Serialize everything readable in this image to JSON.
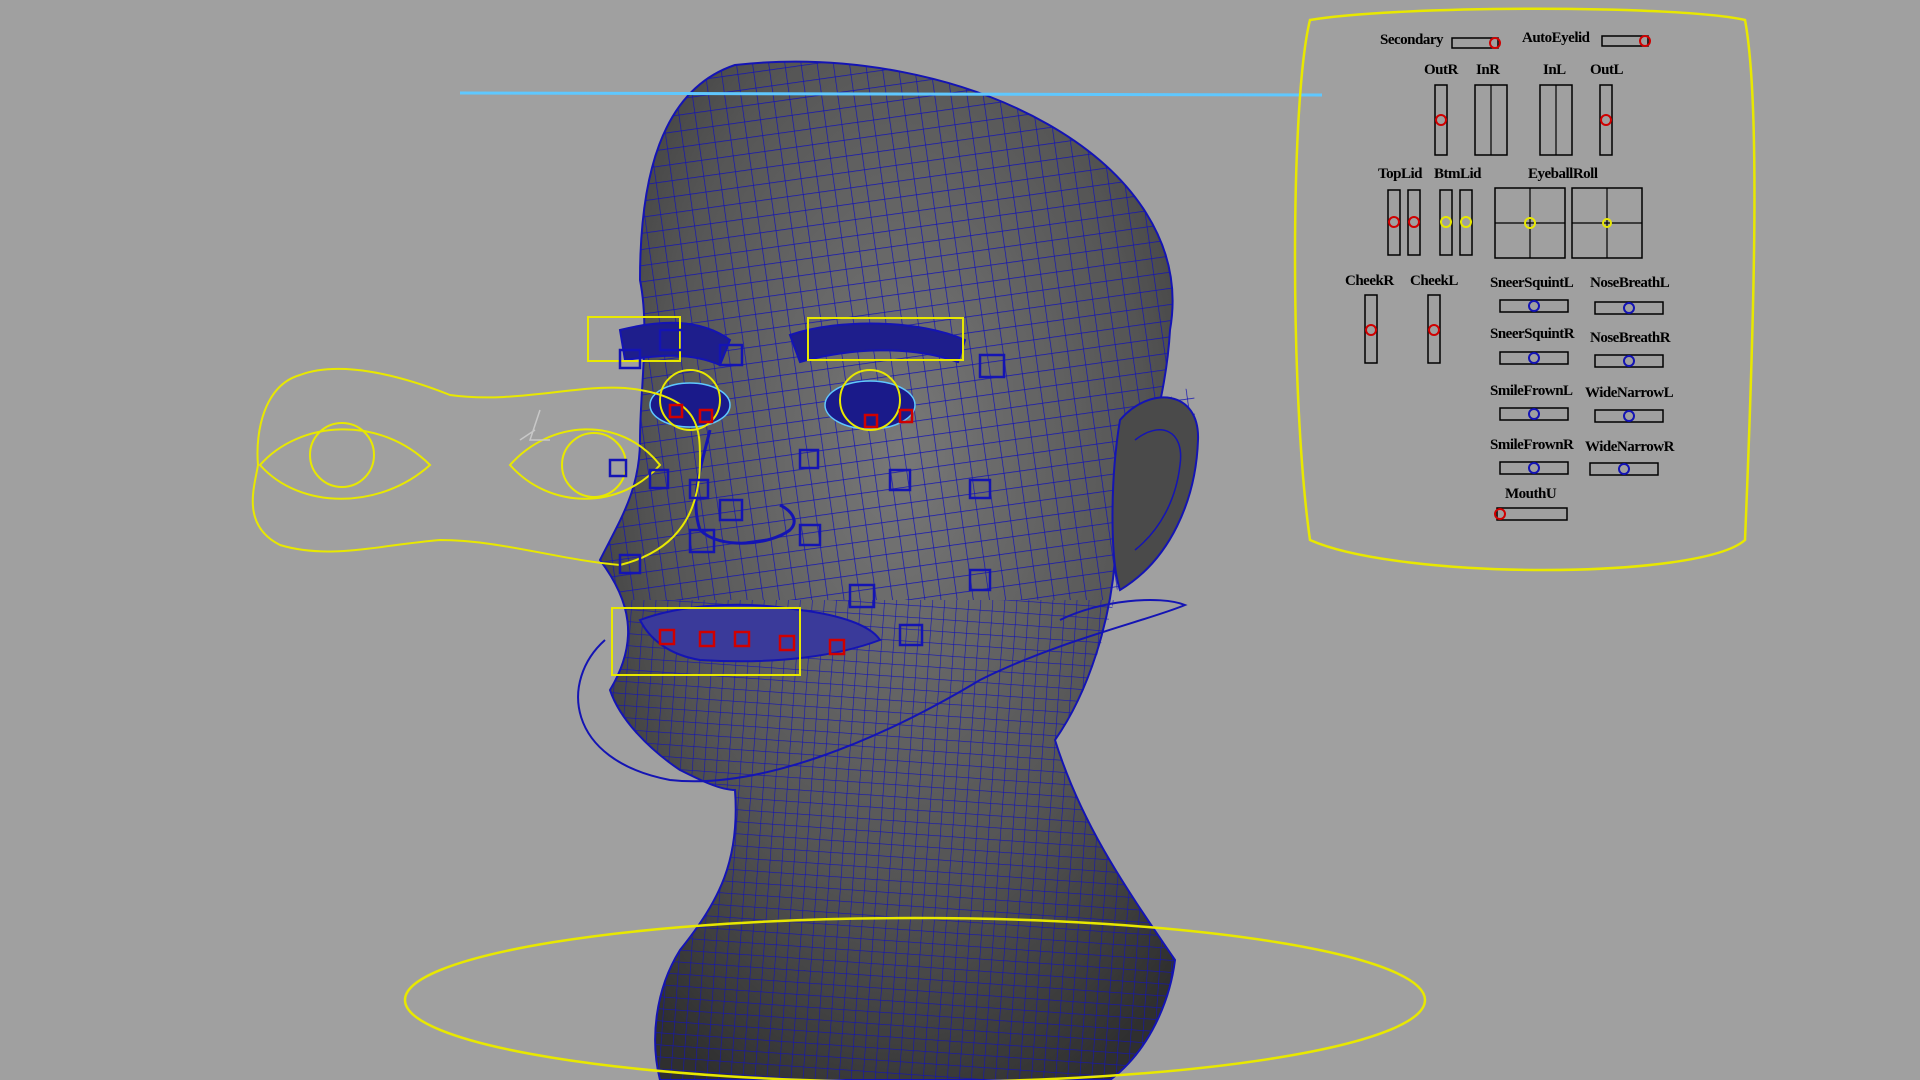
{
  "viewport": {
    "name": "perspective viewport",
    "background": "#a0a0a0",
    "mesh_color": "#1414b4",
    "curve_color": "#e8e800",
    "selected_color": "#5fc8ff",
    "locator_color": "#d00000"
  },
  "control_panel": {
    "secondary": "Secondary",
    "auto_eyelid": "AutoEyelid",
    "out_r": "OutR",
    "in_r": "InR",
    "in_l": "InL",
    "out_l": "OutL",
    "top_lid": "TopLid",
    "btm_lid": "BtmLid",
    "eyeball_roll": "EyeballRoll",
    "cheek_r": "CheekR",
    "cheek_l": "CheekL",
    "sneer_squint_l": "SneerSquintL",
    "nose_breath_l": "NoseBreathL",
    "sneer_squint_r": "SneerSquintR",
    "nose_breath_r": "NoseBreathR",
    "smile_frown_l": "SmileFrownL",
    "wide_narrow_l": "WideNarrowL",
    "smile_frown_r": "SmileFrownR",
    "wide_narrow_r": "WideNarrowR",
    "mouth_u": "MouthU"
  }
}
